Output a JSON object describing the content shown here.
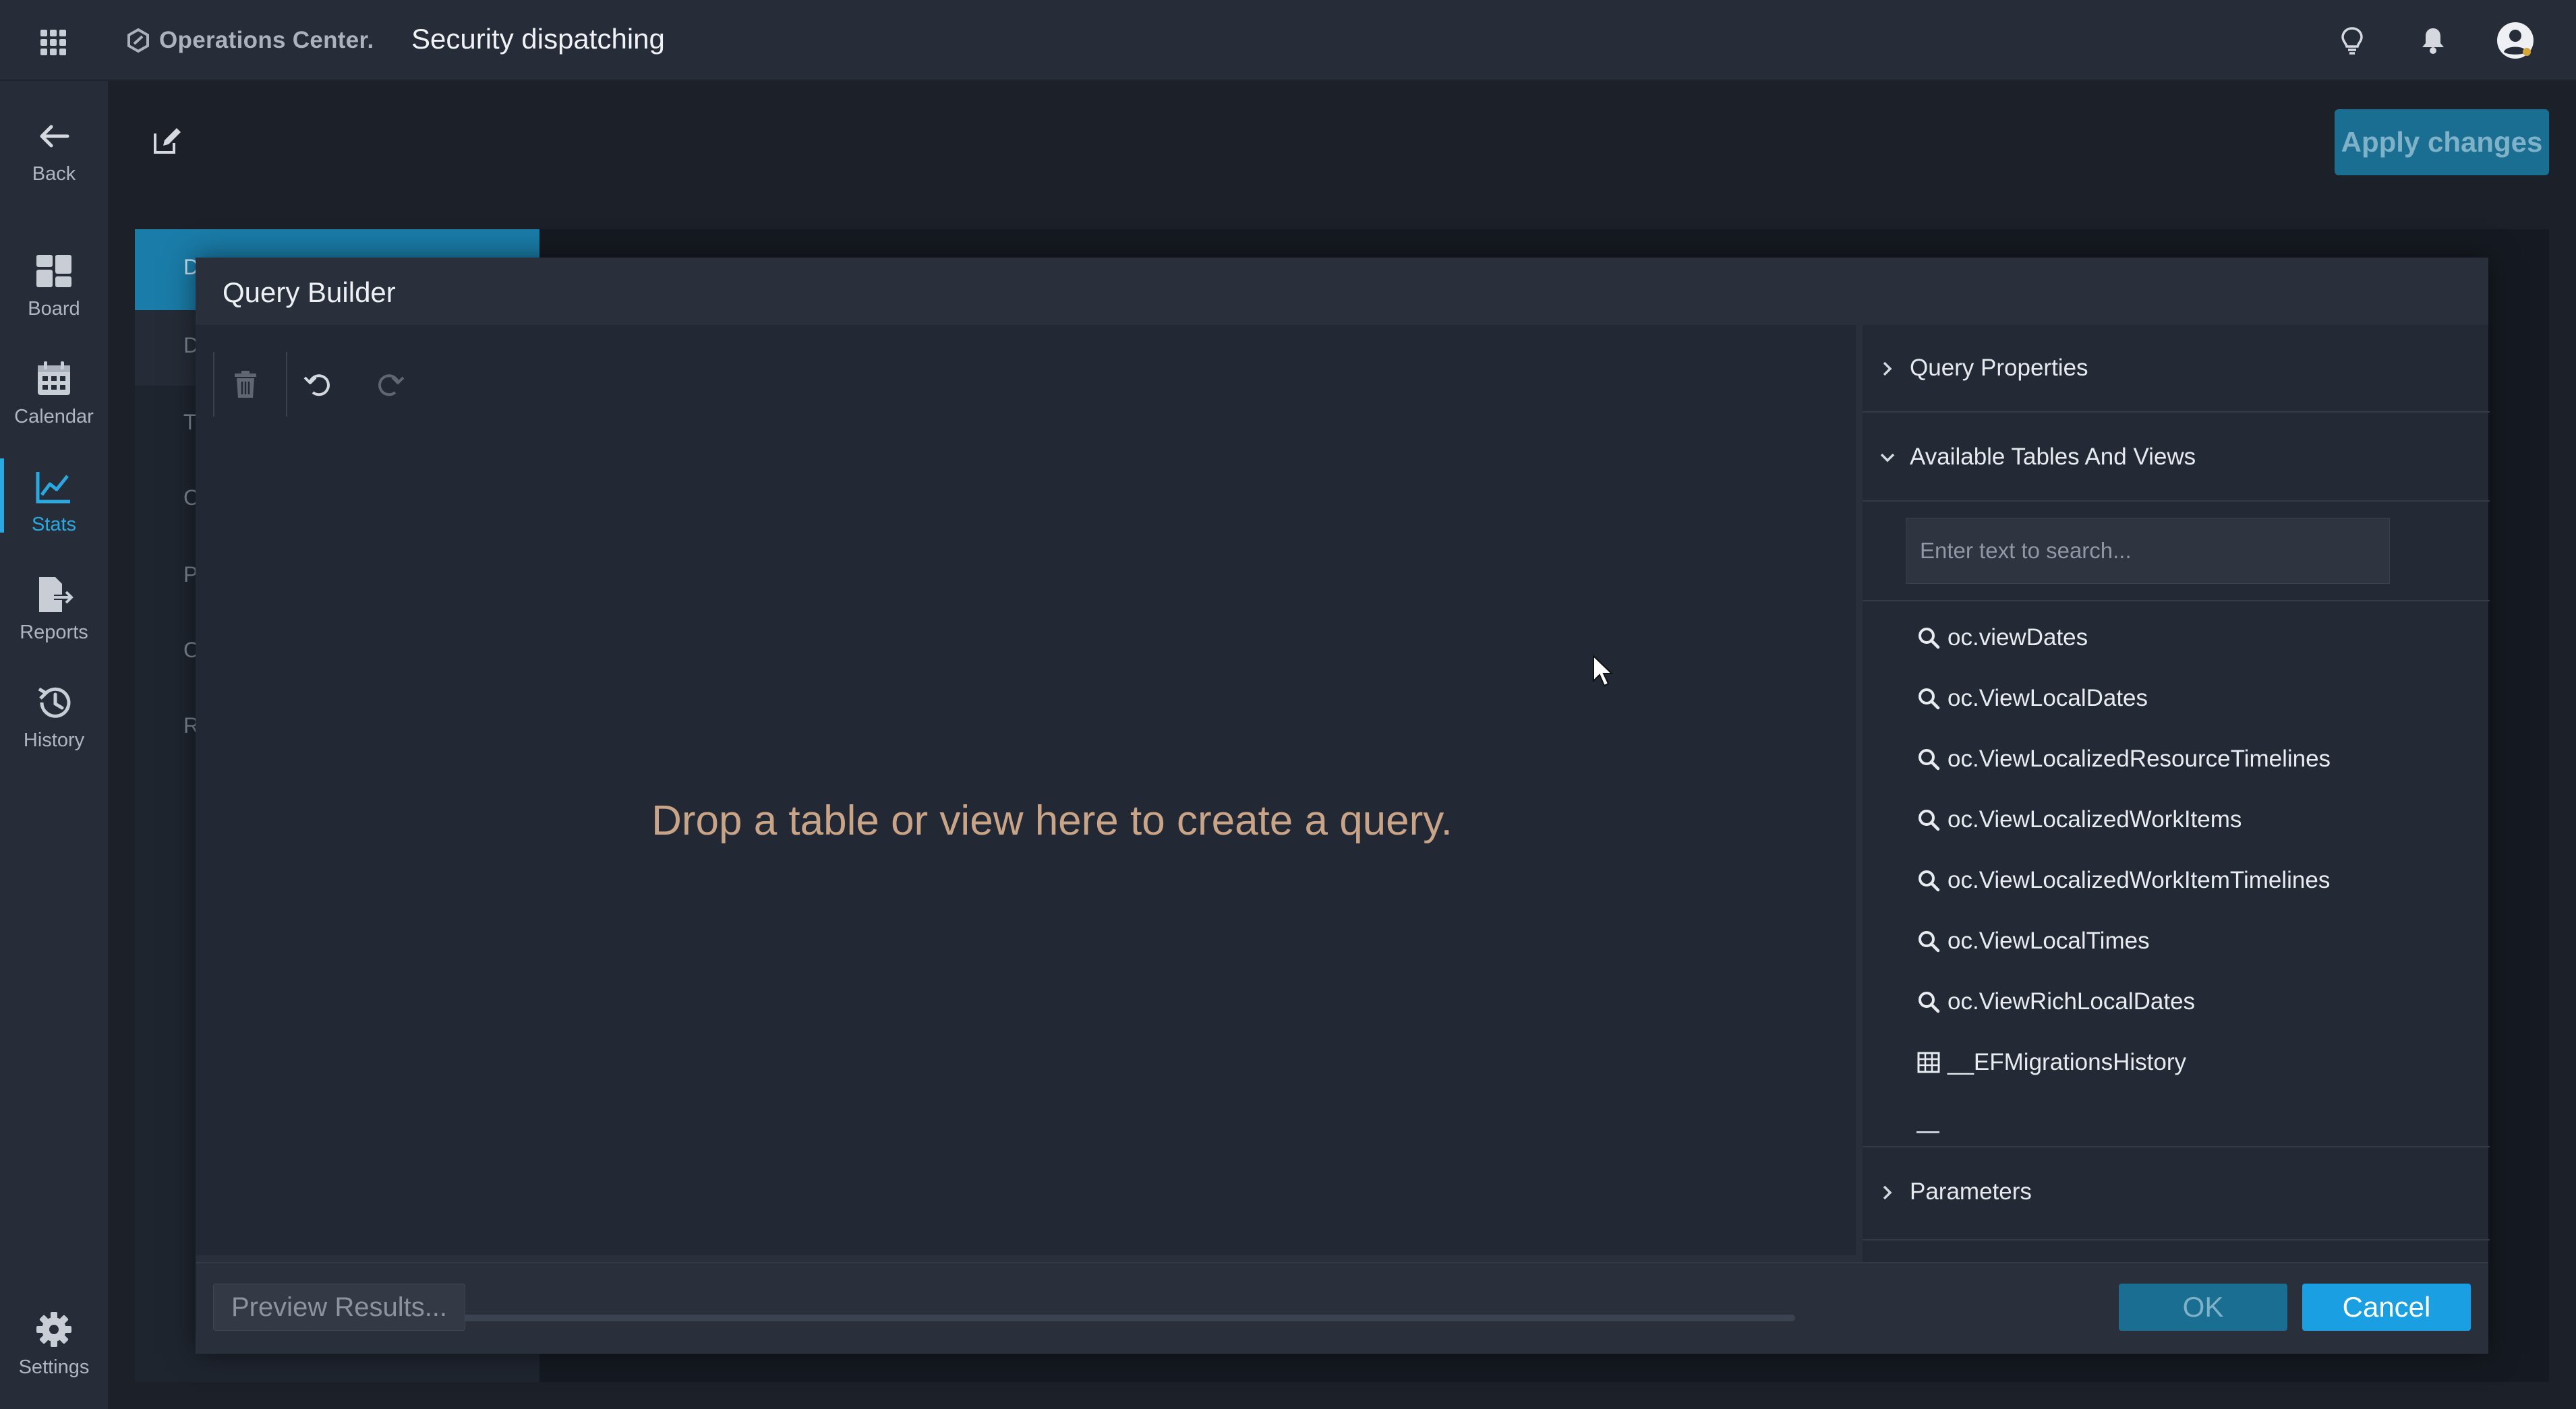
{
  "topbar": {
    "brand_name": "Operations Center.",
    "title": "Security dispatching",
    "icons": [
      "apps-grid-icon",
      "lightbulb-icon",
      "bell-icon",
      "user-avatar-icon"
    ]
  },
  "nav": {
    "items": [
      {
        "label": "Back",
        "icon": "arrow-left-icon"
      },
      {
        "label": "Board",
        "icon": "board-icon"
      },
      {
        "label": "Calendar",
        "icon": "calendar-icon"
      },
      {
        "label": "Stats",
        "icon": "chart-line-icon",
        "active": true
      },
      {
        "label": "Reports",
        "icon": "report-export-icon"
      },
      {
        "label": "History",
        "icon": "history-icon"
      },
      {
        "label": "Settings",
        "icon": "gear-icon"
      }
    ]
  },
  "main": {
    "apply_label": "Apply changes",
    "background_letters": [
      "D",
      "D",
      "T",
      "C",
      "P",
      "C",
      "R"
    ]
  },
  "dialog": {
    "title": "Query Builder",
    "toolbar": [
      "trash-icon",
      "undo-icon",
      "redo-icon"
    ],
    "drop_hint": "Drop a table or view here to create a query.",
    "sections": {
      "query_properties": "Query Properties",
      "available_tables": "Available Tables And Views",
      "parameters": "Parameters"
    },
    "search": {
      "placeholder": "Enter text to search...",
      "value": ""
    },
    "tables": [
      {
        "name": "oc.viewDates",
        "icon": "view-search-icon"
      },
      {
        "name": "oc.ViewLocalDates",
        "icon": "view-search-icon"
      },
      {
        "name": "oc.ViewLocalizedResourceTimelines",
        "icon": "view-search-icon"
      },
      {
        "name": "oc.ViewLocalizedWorkItems",
        "icon": "view-search-icon"
      },
      {
        "name": "oc.ViewLocalizedWorkItemTimelines",
        "icon": "view-search-icon"
      },
      {
        "name": "oc.ViewLocalTimes",
        "icon": "view-search-icon"
      },
      {
        "name": "oc.ViewRichLocalDates",
        "icon": "view-search-icon"
      },
      {
        "name": "__EFMigrationsHistory",
        "icon": "table-grid-icon"
      }
    ],
    "footer": {
      "preview_label": "Preview Results...",
      "ok_label": "OK",
      "cancel_label": "Cancel"
    }
  },
  "colors": {
    "accent": "#1aa0e2",
    "topbar_bg": "#272d38",
    "dialog_bg": "#2a303b",
    "hint_text": "#c9a487"
  }
}
